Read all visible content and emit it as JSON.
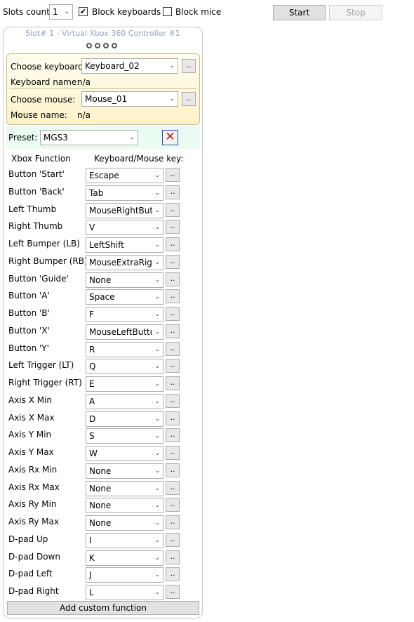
{
  "toolbar": {
    "slots_label": "Slots count:",
    "slots_value": "1",
    "block_keyboards_label": "Block keyboards",
    "block_keyboards_checked": true,
    "block_mice_label": "Block mice",
    "block_mice_checked": false,
    "start_label": "Start",
    "stop_label": "Stop"
  },
  "slot": {
    "title": "Slot# 1 - Virtual Xbox 360 Controller #1",
    "keyboard_label": "Choose keyboard:",
    "keyboard_value": "Keyboard_02",
    "keyboard_name_label": "Keyboard name:",
    "keyboard_name_value": "n/a",
    "mouse_label": "Choose mouse:",
    "mouse_value": "Mouse_01",
    "mouse_name_label": "Mouse name:",
    "mouse_name_value": "n/a",
    "browse_label": "..",
    "preset_label": "Preset:",
    "preset_value": "MGS3",
    "header_function": "Xbox Function",
    "header_key": "Keyboard/Mouse key:",
    "mappings": [
      {
        "function": "Button 'Start'",
        "key": "Escape"
      },
      {
        "function": "Button 'Back'",
        "key": "Tab"
      },
      {
        "function": "Left Thumb",
        "key": "MouseRightButton"
      },
      {
        "function": "Right Thumb",
        "key": "V"
      },
      {
        "function": "Left Bumper (LB)",
        "key": "LeftShift"
      },
      {
        "function": "Right Bumper (RB)",
        "key": "MouseExtraRight"
      },
      {
        "function": "Button 'Guide'",
        "key": "None"
      },
      {
        "function": "Button 'A'",
        "key": "Space"
      },
      {
        "function": "Button 'B'",
        "key": "F"
      },
      {
        "function": "Button 'X'",
        "key": "MouseLeftButton"
      },
      {
        "function": "Button 'Y'",
        "key": "R"
      },
      {
        "function": "Left Trigger (LT)",
        "key": "Q"
      },
      {
        "function": "Right Trigger (RT)",
        "key": "E"
      },
      {
        "function": "Axis X Min",
        "key": "A"
      },
      {
        "function": "Axis X Max",
        "key": "D"
      },
      {
        "function": "Axis Y Min",
        "key": "S"
      },
      {
        "function": "Axis Y Max",
        "key": "W"
      },
      {
        "function": "Axis Rx Min",
        "key": "None"
      },
      {
        "function": "Axis Rx Max",
        "key": "None"
      },
      {
        "function": "Axis Ry Min",
        "key": "None"
      },
      {
        "function": "Axis Ry Max",
        "key": "None"
      },
      {
        "function": "D-pad Up",
        "key": "I"
      },
      {
        "function": "D-pad Down",
        "key": "K"
      },
      {
        "function": "D-pad Left",
        "key": "J"
      },
      {
        "function": "D-pad Right",
        "key": "L"
      }
    ],
    "add_custom_label": "Add custom function"
  },
  "icons": {
    "chevron": "chevron-down-icon",
    "delete": "red-x-icon",
    "checkmark": "checkmark-icon"
  }
}
